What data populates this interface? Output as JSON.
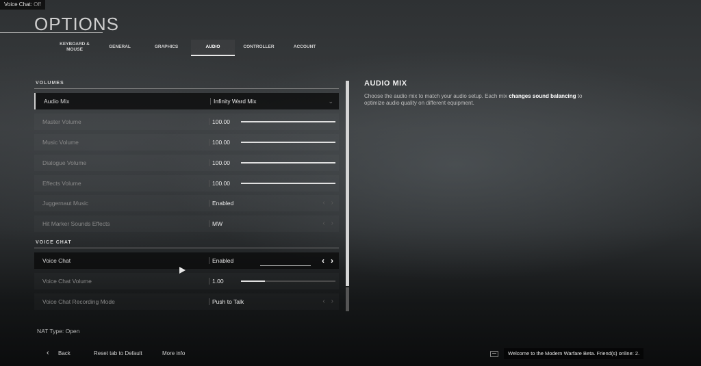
{
  "topbar": {
    "label": "Voice Chat:",
    "value": "Off"
  },
  "page": {
    "title": "OPTIONS"
  },
  "tabs": [
    {
      "label": "KEYBOARD & MOUSE"
    },
    {
      "label": "GENERAL"
    },
    {
      "label": "GRAPHICS"
    },
    {
      "label": "AUDIO",
      "active": true
    },
    {
      "label": "CONTROLLER"
    },
    {
      "label": "ACCOUNT"
    }
  ],
  "volumes": {
    "heading": "VOLUMES",
    "audio_mix": {
      "label": "Audio Mix",
      "value": "Infinity Ward Mix"
    },
    "master_volume": {
      "label": "Master Volume",
      "value": "100.00",
      "level": 1.0
    },
    "music_volume": {
      "label": "Music Volume",
      "value": "100.00",
      "level": 1.0
    },
    "dialogue_volume": {
      "label": "Dialogue Volume",
      "value": "100.00",
      "level": 1.0
    },
    "effects_volume": {
      "label": "Effects Volume",
      "value": "100.00",
      "level": 1.0
    },
    "juggernaut_music": {
      "label": "Juggernaut Music",
      "value": "Enabled"
    },
    "hit_marker": {
      "label": "Hit Marker Sounds Effects",
      "value": "MW"
    }
  },
  "voice_chat": {
    "heading": "VOICE CHAT",
    "voice_chat": {
      "label": "Voice Chat",
      "value": "Enabled"
    },
    "voice_chat_volume": {
      "label": "Voice Chat Volume",
      "value": "1.00",
      "level": 0.25
    },
    "recording_mode": {
      "label": "Voice Chat Recording Mode",
      "value": "Push to Talk"
    }
  },
  "info_panel": {
    "title": "AUDIO MIX",
    "desc_1": "Choose the audio mix to match your audio setup. Each mix ",
    "desc_bold_1": "changes sound",
    "desc_bold_2": "balancing",
    "desc_2": " to optimize audio quality on different equipment."
  },
  "nat": {
    "text": "NAT Type: Open"
  },
  "footer": {
    "back": "Back",
    "reset": "Reset tab to Default",
    "more_info": "More info",
    "welcome": "Welcome to the Modern Warfare Beta. Friend(s) online: 2."
  },
  "icons": {
    "chevron_left": "‹",
    "chevron_right": "›",
    "dropdown": "⌄"
  }
}
